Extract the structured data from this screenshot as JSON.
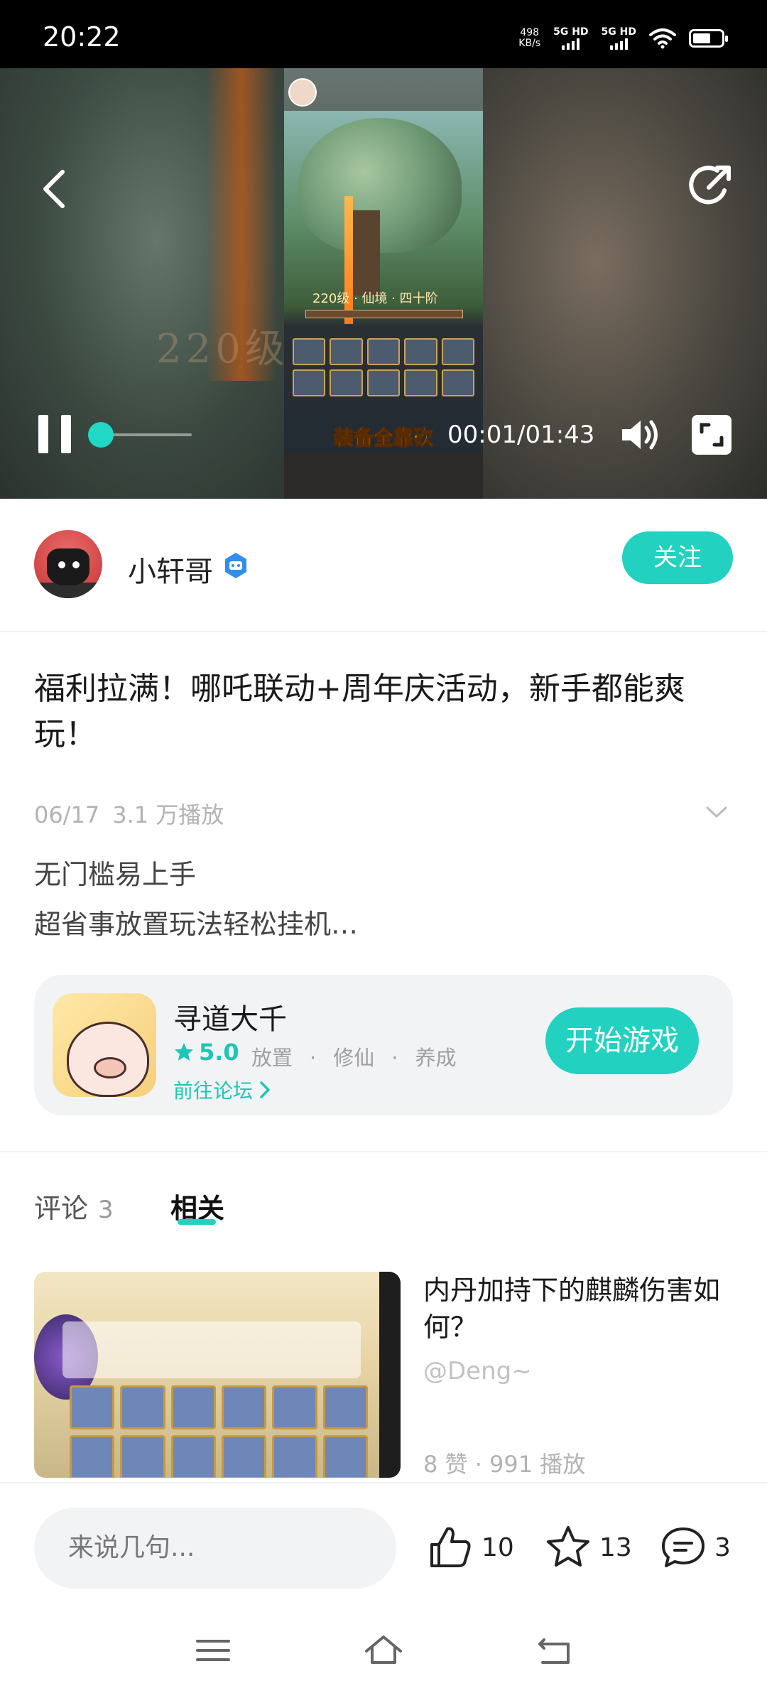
{
  "status_bar": {
    "time": "20:22",
    "net_speed_value": "498",
    "net_speed_unit": "KB/s",
    "sim1": "5G HD",
    "sim2": "5G HD",
    "battery_level": 0.55
  },
  "video": {
    "caption": "装备全靠砍",
    "overlay_level_text": "220级 · 仙境 · 四十阶",
    "background_text": "220级",
    "time": "00:01/01:43",
    "progress": 0.01
  },
  "author": {
    "name": "小轩哥",
    "follow_label": "关注"
  },
  "post": {
    "title": "福利拉满！哪吒联动+周年庆活动，新手都能爽玩！",
    "date": "06/17",
    "views": "3.1 万播放",
    "desc_line1": "无门槛易上手",
    "desc_line2": "超省事放置玩法轻松挂机…"
  },
  "game": {
    "name": "寻道大千",
    "rating": "5.0",
    "tags": [
      "放置",
      "修仙",
      "养成"
    ],
    "forum_link": "前往论坛",
    "start_label": "开始游戏"
  },
  "tabs": {
    "comments_label": "评论",
    "comments_count": "3",
    "related_label": "相关"
  },
  "related": {
    "title": "内丹加持下的麒麟伤害如何？",
    "author": "@Deng~",
    "stats": "8 赞 · 991 播放"
  },
  "bottom_bar": {
    "input_placeholder": "来说几句...",
    "likes": "10",
    "favorites": "13",
    "comments": "3"
  },
  "colors": {
    "accent": "#22d1c0",
    "status_bar_bg": "#000000",
    "card_bg": "#f2f3f5"
  }
}
